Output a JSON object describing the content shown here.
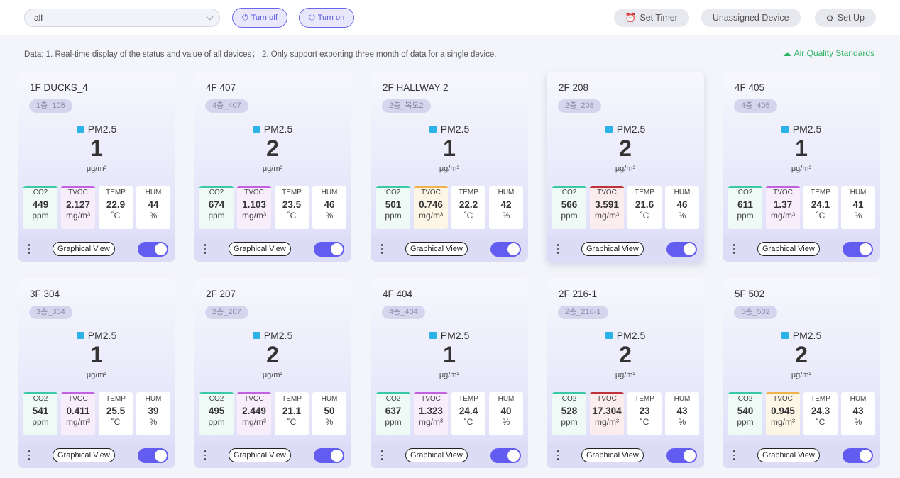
{
  "toolbar": {
    "select_value": "all",
    "turn_off": "Turn off",
    "turn_on": "Turn on",
    "set_timer": "Set Timer",
    "unassigned": "Unassigned Device",
    "set_up": "Set Up"
  },
  "info_text": "Data: 1. Real-time display of the status and value of all devices； 2. Only support exporting three month of data for a single device.",
  "aqs_link": "Air Quality Standards",
  "labels": {
    "pm": "PM2.5",
    "pm_unit": "μg/m³",
    "co2": "CO2",
    "tvoc": "TVOC",
    "temp": "TEMP",
    "hum": "HUM",
    "co2_unit": "ppm",
    "tvoc_unit": "mg/m³",
    "temp_unit": "˚C",
    "hum_unit": "%",
    "graph_btn": "Graphical View"
  },
  "colors": {
    "accent": "#625cf0",
    "link_green": "#2eb062",
    "co2_bar": "#3ac9a8",
    "tvoc_purple": "#c262e0",
    "tvoc_orange": "#f0b24a",
    "tvoc_red": "#c0323a"
  },
  "devices": [
    {
      "name": "1F DUCKS_4",
      "tag": "1층_105",
      "pm": "1",
      "co2": "449",
      "tvoc": "2.127",
      "tvoc_level": "purple",
      "temp": "22.9",
      "hum": "44",
      "on": true
    },
    {
      "name": "4F 407",
      "tag": "4층_407",
      "pm": "2",
      "co2": "674",
      "tvoc": "1.103",
      "tvoc_level": "purple",
      "temp": "23.5",
      "hum": "46",
      "on": true
    },
    {
      "name": "2F HALLWAY 2",
      "tag": "2층_복도2",
      "pm": "1",
      "co2": "501",
      "tvoc": "0.746",
      "tvoc_level": "orange",
      "temp": "22.2",
      "hum": "42",
      "on": true
    },
    {
      "name": "2F 208",
      "tag": "2층_208",
      "pm": "2",
      "co2": "566",
      "tvoc": "3.591",
      "tvoc_level": "red",
      "temp": "21.6",
      "hum": "46",
      "on": true
    },
    {
      "name": "4F 405",
      "tag": "4층_405",
      "pm": "1",
      "co2": "611",
      "tvoc": "1.37",
      "tvoc_level": "purple",
      "temp": "24.1",
      "hum": "41",
      "on": true
    },
    {
      "name": "3F 304",
      "tag": "3층_304",
      "pm": "1",
      "co2": "541",
      "tvoc": "0.411",
      "tvoc_level": "purple",
      "temp": "25.5",
      "hum": "39",
      "on": true
    },
    {
      "name": "2F 207",
      "tag": "2층_207",
      "pm": "2",
      "co2": "495",
      "tvoc": "2.449",
      "tvoc_level": "purple",
      "temp": "21.1",
      "hum": "50",
      "on": true
    },
    {
      "name": "4F 404",
      "tag": "4층_404",
      "pm": "1",
      "co2": "637",
      "tvoc": "1.323",
      "tvoc_level": "purple",
      "temp": "24.4",
      "hum": "40",
      "on": true
    },
    {
      "name": "2F 216-1",
      "tag": "2층_216-1",
      "pm": "2",
      "co2": "528",
      "tvoc": "17.304",
      "tvoc_level": "red",
      "temp": "23",
      "hum": "43",
      "on": true
    },
    {
      "name": "5F 502",
      "tag": "5층_502",
      "pm": "2",
      "co2": "540",
      "tvoc": "0.945",
      "tvoc_level": "orange",
      "temp": "24.3",
      "hum": "43",
      "on": true
    }
  ]
}
